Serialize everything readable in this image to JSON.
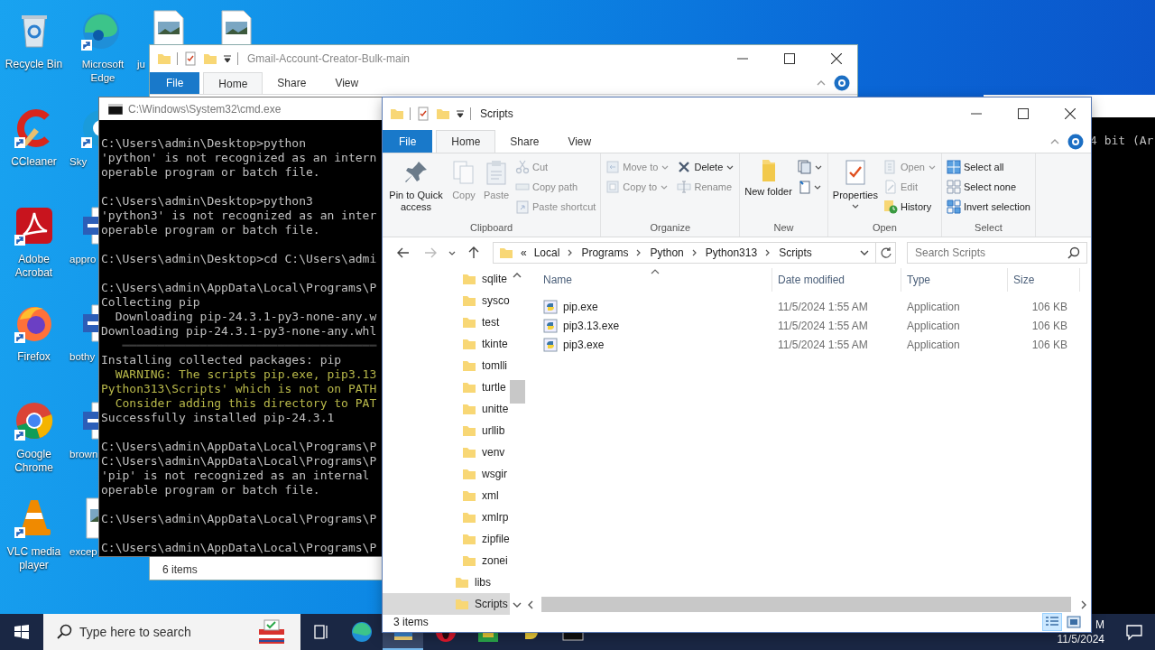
{
  "desktop_columns": [
    [
      {
        "label": "Recycle Bin",
        "kind": "recycle",
        "shortcut": false
      },
      {
        "label": "CCleaner",
        "kind": "ccleaner",
        "shortcut": true
      },
      {
        "label": "Adobe Acrobat",
        "kind": "acrobat",
        "shortcut": true
      },
      {
        "label": "Firefox",
        "kind": "firefox",
        "shortcut": true
      },
      {
        "label": "Google Chrome",
        "kind": "chrome",
        "shortcut": true
      },
      {
        "label": "VLC media player",
        "kind": "vlc",
        "shortcut": true
      }
    ],
    [
      {
        "label": "Microsoft Edge",
        "kind": "edge",
        "shortcut": true
      },
      {
        "label": "Sky",
        "kind": "skype",
        "shortcut": true
      },
      {
        "label": "appro",
        "kind": "word",
        "shortcut": false
      },
      {
        "label": "bothy",
        "kind": "word",
        "shortcut": false
      },
      {
        "label": "brown",
        "kind": "word",
        "shortcut": false
      },
      {
        "label": "excep",
        "kind": "imgfile",
        "shortcut": false
      }
    ],
    [
      {
        "label": "ju",
        "kind": "imgfile",
        "shortcut": false
      }
    ],
    [
      {
        "kind": "imgfile",
        "shortcut": false
      }
    ]
  ],
  "back_explorer": {
    "title": "Gmail-Account-Creator-Bulk-main",
    "tabs": [
      {
        "label": "File",
        "kind": "file",
        "selected": false
      },
      {
        "label": "Home",
        "kind": "tab",
        "selected": true
      },
      {
        "label": "Share",
        "kind": "tab",
        "selected": false
      },
      {
        "label": "View",
        "kind": "tab",
        "selected": false
      }
    ],
    "status": "6 items"
  },
  "right_console": {
    "line": "4 bit (Ar"
  },
  "cmd": {
    "title": "C:\\Windows\\System32\\cmd.exe",
    "lines": [
      {
        "kind": "normal",
        "text": "C:\\Users\\admin\\Desktop>python"
      },
      {
        "kind": "normal",
        "text": "'python' is not recognized as an intern"
      },
      {
        "kind": "normal",
        "text": "operable program or batch file."
      },
      {
        "kind": "blank"
      },
      {
        "kind": "normal",
        "text": "C:\\Users\\admin\\Desktop>python3"
      },
      {
        "kind": "normal",
        "text": "'python3' is not recognized as an inter"
      },
      {
        "kind": "normal",
        "text": "operable program or batch file."
      },
      {
        "kind": "blank"
      },
      {
        "kind": "normal",
        "text": "C:\\Users\\admin\\Desktop>cd C:\\Users\\admi"
      },
      {
        "kind": "blank"
      },
      {
        "kind": "normal",
        "text": "C:\\Users\\admin\\AppData\\Local\\Programs\\P"
      },
      {
        "kind": "normal",
        "text": "Collecting pip"
      },
      {
        "kind": "normal",
        "text": "  Downloading pip-24.3.1-py3-none-any.w"
      },
      {
        "kind": "normal",
        "text": "Downloading pip-24.3.1-py3-none-any.whl"
      },
      {
        "kind": "progress",
        "text": "   ━━━━━━━━━━━━━━━━━━━━━━━━━━━━━━━━━━━━"
      },
      {
        "kind": "normal",
        "text": "Installing collected packages: pip"
      },
      {
        "kind": "warning",
        "text": "  WARNING: The scripts pip.exe, pip3.13"
      },
      {
        "kind": "warning",
        "text": "Python313\\Scripts' which is not on PATH"
      },
      {
        "kind": "warning",
        "text": "  Consider adding this directory to PAT"
      },
      {
        "kind": "normal",
        "text": "Successfully installed pip-24.3.1"
      },
      {
        "kind": "blank"
      },
      {
        "kind": "normal",
        "text": "C:\\Users\\admin\\AppData\\Local\\Programs\\P"
      },
      {
        "kind": "normal",
        "text": "C:\\Users\\admin\\AppData\\Local\\Programs\\P"
      },
      {
        "kind": "normal",
        "text": "'pip' is not recognized as an internal"
      },
      {
        "kind": "normal",
        "text": "operable program or batch file."
      },
      {
        "kind": "blank"
      },
      {
        "kind": "normal",
        "text": "C:\\Users\\admin\\AppData\\Local\\Programs\\P"
      },
      {
        "kind": "blank"
      },
      {
        "kind": "normal",
        "text": "C:\\Users\\admin\\AppData\\Local\\Programs\\P"
      }
    ]
  },
  "explorer": {
    "title": "Scripts",
    "tabs": [
      {
        "label": "File",
        "kind": "file",
        "selected": false
      },
      {
        "label": "Home",
        "kind": "tab",
        "selected": true
      },
      {
        "label": "Share",
        "kind": "tab",
        "selected": false
      },
      {
        "label": "View",
        "kind": "tab",
        "selected": false
      }
    ],
    "ribbon": {
      "groups": [
        {
          "label": "Clipboard",
          "commands": [
            {
              "label": "Pin to Quick access",
              "kind": "large",
              "disabled": false
            },
            {
              "label": "Copy",
              "kind": "large",
              "disabled": true
            },
            {
              "label": "Paste",
              "kind": "large",
              "disabled": true
            },
            {
              "label": "Cut",
              "kind": "small",
              "disabled": true
            },
            {
              "label": "Copy path",
              "kind": "small",
              "disabled": true
            },
            {
              "label": "Paste shortcut",
              "kind": "small",
              "disabled": true
            }
          ]
        },
        {
          "label": "Organize",
          "commands": [
            {
              "label": "Move to",
              "kind": "small",
              "disabled": true,
              "dropdown": true
            },
            {
              "label": "Copy to",
              "kind": "small",
              "disabled": true,
              "dropdown": true
            },
            {
              "label": "Delete",
              "kind": "small",
              "disabled": false,
              "dropdown": true
            },
            {
              "label": "Rename",
              "kind": "small",
              "disabled": true
            }
          ]
        },
        {
          "label": "New",
          "commands": [
            {
              "label": "New folder",
              "kind": "large",
              "disabled": false
            },
            {
              "kind": "small",
              "disabled": false,
              "dropdown": true
            },
            {
              "kind": "small",
              "disabled": false,
              "dropdown": true
            }
          ]
        },
        {
          "label": "Open",
          "commands": [
            {
              "label": "Properties",
              "kind": "large",
              "disabled": false,
              "dropdown": true
            },
            {
              "label": "Open",
              "kind": "small",
              "disabled": true,
              "dropdown": true
            },
            {
              "label": "Edit",
              "kind": "small",
              "disabled": true
            },
            {
              "label": "History",
              "kind": "small",
              "disabled": false
            }
          ]
        },
        {
          "label": "Select",
          "commands": [
            {
              "label": "Select all",
              "kind": "small",
              "disabled": false
            },
            {
              "label": "Select none",
              "kind": "small",
              "disabled": false
            },
            {
              "label": "Invert selection",
              "kind": "small",
              "disabled": false
            }
          ]
        }
      ]
    },
    "address": {
      "overflow": "«",
      "crumbs": [
        "Local",
        "Programs",
        "Python",
        "Python313",
        "Scripts"
      ]
    },
    "search": {
      "placeholder": "Search Scripts"
    },
    "nav_tree": [
      {
        "children": [
          {
            "label": "sqlite",
            "selected": false
          },
          {
            "label": "sysco",
            "selected": false
          },
          {
            "label": "test",
            "selected": false
          },
          {
            "label": "tkinte",
            "selected": false
          },
          {
            "label": "tomlli",
            "selected": false
          },
          {
            "label": "turtle",
            "selected": false
          },
          {
            "label": "unitte",
            "selected": false
          },
          {
            "label": "urllib",
            "selected": false
          },
          {
            "label": "venv",
            "selected": false
          },
          {
            "label": "wsgir",
            "selected": false
          },
          {
            "label": "xml",
            "selected": false
          },
          {
            "label": "xmlrp",
            "selected": false
          },
          {
            "label": "zipfile",
            "selected": false
          },
          {
            "label": "zonei",
            "selected": false
          }
        ]
      },
      {
        "label": "libs",
        "selected": false
      },
      {
        "label": "Scripts",
        "selected": true
      }
    ],
    "columns": [
      {
        "label": "Name",
        "sorted": true
      },
      {
        "label": "Date modified",
        "sorted": false
      },
      {
        "label": "Type",
        "sorted": false
      },
      {
        "label": "Size",
        "sorted": false
      }
    ],
    "files": [
      {
        "name": "pip.exe",
        "date": "11/5/2024 1:55 AM",
        "type": "Application",
        "size": "106 KB",
        "selected": false
      },
      {
        "name": "pip3.13.exe",
        "date": "11/5/2024 1:55 AM",
        "type": "Application",
        "size": "106 KB",
        "selected": false
      },
      {
        "name": "pip3.exe",
        "date": "11/5/2024 1:55 AM",
        "type": "Application",
        "size": "106 KB",
        "selected": false
      }
    ],
    "status": "3 items",
    "view_buttons": [
      {
        "kind": "details",
        "selected": true
      },
      {
        "kind": "large-icons",
        "selected": false
      }
    ]
  },
  "taskbar": {
    "search": {
      "placeholder": "Type here to search"
    },
    "apps": [
      {
        "kind": "taskview",
        "active": false
      },
      {
        "kind": "edge",
        "active": false
      },
      {
        "kind": "explorer",
        "active": true
      },
      {
        "kind": "opera",
        "active": false
      },
      {
        "kind": "greenapp",
        "active": false
      },
      {
        "kind": "python",
        "active": false
      },
      {
        "kind": "cmd",
        "active": false
      }
    ],
    "clock": {
      "time": "M",
      "date": "11/5/2024"
    }
  }
}
